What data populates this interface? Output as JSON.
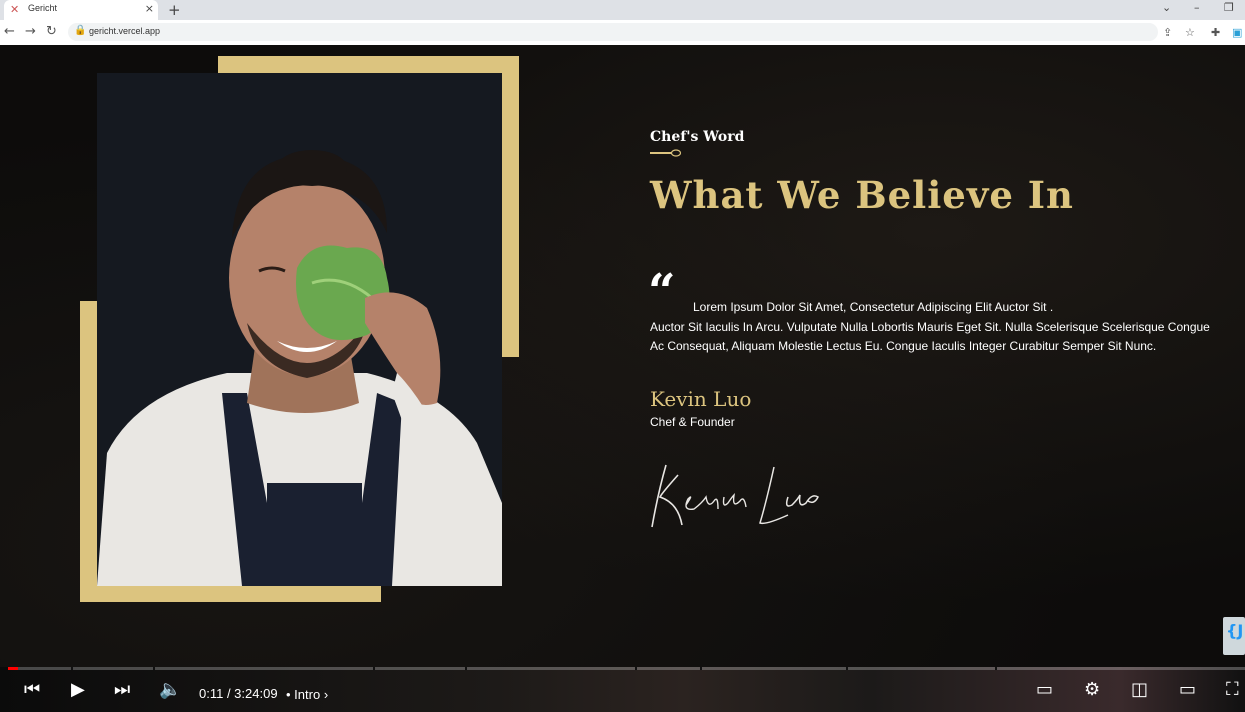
{
  "browser": {
    "tab_title": "Gericht",
    "new_tab": "+",
    "url": "gericht.vercel.app",
    "icons": [
      "favicon-icon",
      "close-tab-icon",
      "new-tab-icon",
      "back-icon",
      "forward-icon",
      "reload-icon",
      "lock-icon",
      "share-icon",
      "star-icon",
      "extensions-icon",
      "profile-icon",
      "minimize-icon",
      "restore-icon",
      "tab-search-icon"
    ]
  },
  "page": {
    "subtitle": "Chef's Word",
    "headline": "What We Believe In",
    "quote_mark": "“",
    "quote_first": "Lorem Ipsum Dolor Sit Amet, Consectetur Adipiscing Elit Auctor Sit .",
    "quote_rest": "Auctor Sit Iaculis In Arcu. Vulputate Nulla Lobortis Mauris Eget Sit. Nulla Scelerisque Scelerisque Congue Ac Consequat, Aliquam Molestie Lectus Eu. Congue Iaculis Integer Curabitur Semper Sit Nunc.",
    "author": "Kevin Luo",
    "role": "Chef & Founder",
    "signature_text": "Kevin Luo",
    "badge_text": "{J",
    "colors": {
      "gold": "#dcc47f",
      "background": "#0d0c0b",
      "text": "#ffffff"
    }
  },
  "video": {
    "time": "0:11 / 3:24:09",
    "chapter": "• Intro",
    "progress_fraction": 0.0009,
    "icons": [
      "previous-icon",
      "play-icon",
      "next-icon",
      "volume-icon",
      "chapter-chevron-icon",
      "subtitles-icon",
      "settings-icon",
      "miniplayer-icon",
      "theater-icon",
      "fullscreen-icon"
    ]
  }
}
